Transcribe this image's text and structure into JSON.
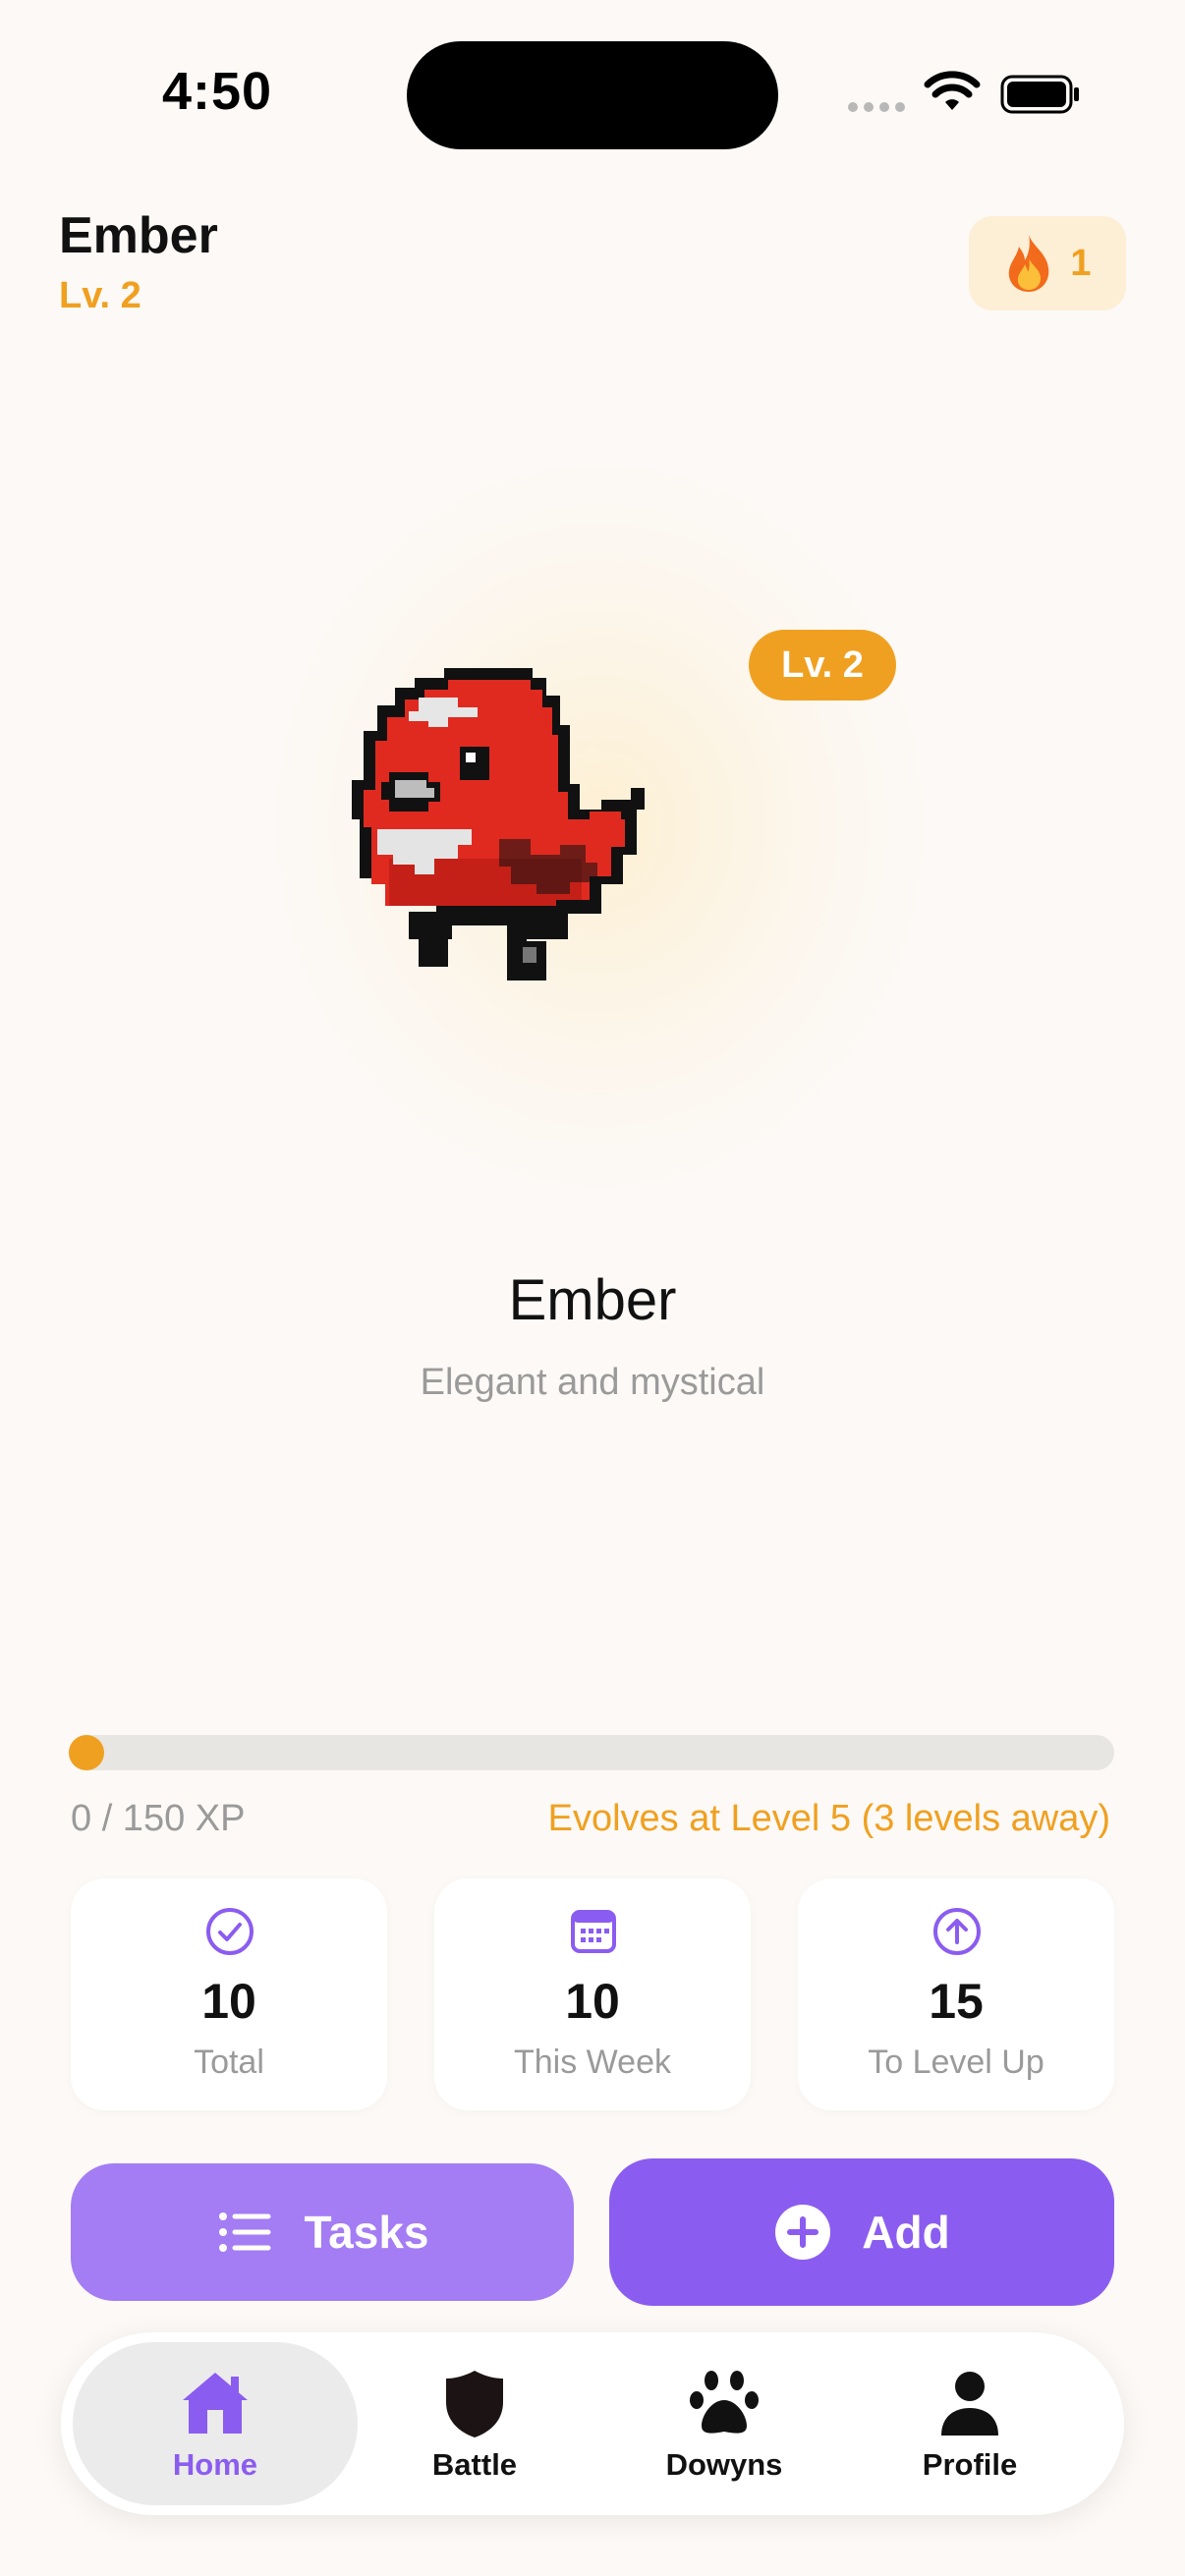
{
  "status_bar": {
    "time": "4:50"
  },
  "header": {
    "pet_name": "Ember",
    "level": "Lv. 2",
    "streak_count": "1"
  },
  "hero": {
    "level_badge": "Lv. 2",
    "name": "Ember",
    "description": "Elegant and mystical"
  },
  "xp": {
    "progress_fraction": 0.0,
    "label": "0 / 150 XP",
    "evolve_text": "Evolves at Level 5 (3 levels away)"
  },
  "stats": [
    {
      "icon": "check-circle-icon",
      "value": "10",
      "label": "Total"
    },
    {
      "icon": "calendar-icon",
      "value": "10",
      "label": "This Week"
    },
    {
      "icon": "arrow-up-circle-icon",
      "value": "15",
      "label": "To Level Up"
    }
  ],
  "actions": {
    "tasks_label": "Tasks",
    "add_label": "Add"
  },
  "tabbar": {
    "items": [
      {
        "label": "Home",
        "icon": "home-icon",
        "active": true
      },
      {
        "label": "Battle",
        "icon": "shield-icon",
        "active": false
      },
      {
        "label": "Dowyns",
        "icon": "paw-icon",
        "active": false
      },
      {
        "label": "Profile",
        "icon": "person-icon",
        "active": false
      }
    ]
  },
  "colors": {
    "accent_orange": "#f0a020",
    "accent_purple": "#8b5cf0",
    "light_purple": "#a47cf4",
    "background": "#fcf9f6"
  }
}
